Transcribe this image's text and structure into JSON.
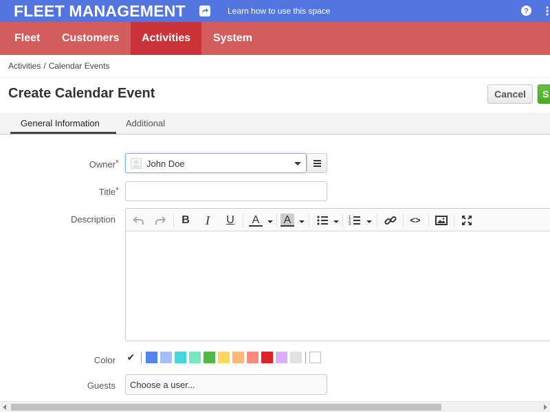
{
  "header": {
    "app_title": "FLEET MANAGEMENT",
    "learn_link": "Learn how to use this space",
    "accent_color": "#5275e0"
  },
  "nav": {
    "color": "#d35d5d",
    "active_color": "#c93338",
    "items": [
      {
        "label": "Fleet",
        "active": false
      },
      {
        "label": "Customers",
        "active": false
      },
      {
        "label": "Activities",
        "active": true
      },
      {
        "label": "System",
        "active": false
      }
    ]
  },
  "breadcrumb": {
    "items": [
      "Activities",
      "Calendar Events"
    ],
    "separator": "/"
  },
  "page": {
    "title": "Create Calendar Event",
    "cancel_label": "Cancel",
    "save_label": "S"
  },
  "tabs": [
    {
      "label": "General Information",
      "active": true
    },
    {
      "label": "Additional",
      "active": false
    }
  ],
  "form": {
    "owner": {
      "label": "Owner",
      "required_mark": "*",
      "value": "John Doe"
    },
    "title": {
      "label": "Title",
      "required_mark": "*",
      "value": ""
    },
    "description": {
      "label": "Description"
    },
    "color": {
      "label": "Color",
      "selected_mark": "✔",
      "swatches": [
        "#5484ed",
        "#a4bdfc",
        "#46d6db",
        "#7ae7bf",
        "#51b749",
        "#fbd75b",
        "#ffb878",
        "#ff887c",
        "#dc2127",
        "#dbadff",
        "#e1e1e1",
        "#ffffff"
      ]
    },
    "guests": {
      "label": "Guests",
      "placeholder": "Choose a user..."
    }
  },
  "editor_toolbar": {
    "icons": [
      "undo-icon",
      "redo-icon",
      "bold-icon",
      "italic-icon",
      "underline-icon",
      "text-color-icon",
      "background-color-icon",
      "bullet-list-icon",
      "numbered-list-icon",
      "link-icon",
      "code-icon",
      "image-icon",
      "fullscreen-icon"
    ],
    "bold_glyph": "B",
    "italic_glyph": "I",
    "underline_glyph": "U",
    "text_color_glyph": "A",
    "bg_color_glyph": "A",
    "code_glyph": "<>"
  }
}
